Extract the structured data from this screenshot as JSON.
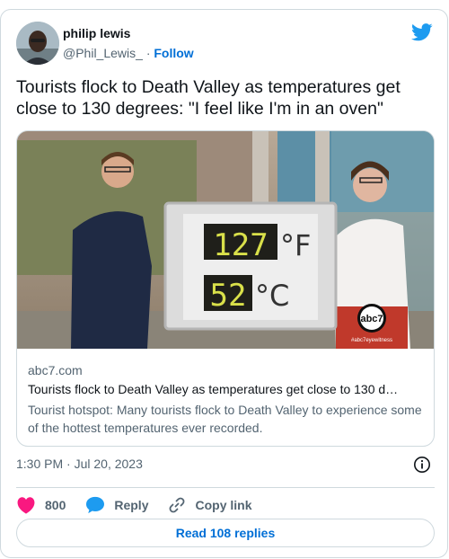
{
  "author": {
    "name": "philip lewis",
    "handle": "@Phil_Lewis_",
    "separator": "·",
    "follow_label": "Follow"
  },
  "tweet": {
    "text": "Tourists flock to Death Valley as temperatures get close to 130 degrees: \"I feel like I'm in an oven\""
  },
  "media": {
    "sign_fahrenheit": "127",
    "sign_fahrenheit_unit": "°F",
    "sign_celsius": "52",
    "sign_celsius_unit": "°C",
    "watermark_logo": "abc7",
    "watermark_tag": "#abc7eyewitness"
  },
  "link_card": {
    "domain": "abc7.com",
    "title": "Tourists flock to Death Valley as temperatures get close to 130 d…",
    "description": "Tourist hotspot: Many tourists flock to Death Valley to experience some of the hottest temperatures ever recorded."
  },
  "timestamp": "1:30 PM · Jul 20, 2023",
  "actions": {
    "like_count": "800",
    "reply_label": "Reply",
    "copy_link_label": "Copy link"
  },
  "read_replies_label": "Read 108 replies",
  "colors": {
    "accent": "#006fd6",
    "twitter_blue": "#1d9bf0",
    "like_pink": "#f91880",
    "muted": "#536471",
    "border": "#cfd9de"
  },
  "icons": [
    "avatar",
    "twitter-bird-icon",
    "info-icon",
    "heart-icon",
    "reply-bubble-icon",
    "link-icon"
  ]
}
